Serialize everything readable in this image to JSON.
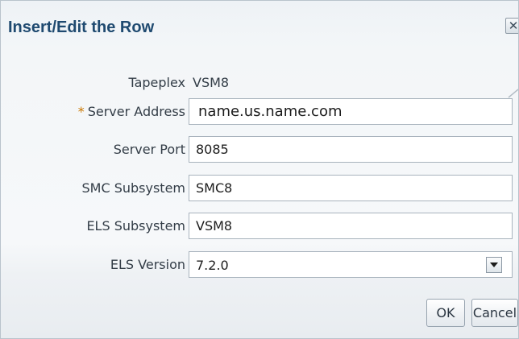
{
  "dialog": {
    "title": "Insert/Edit the Row",
    "close_icon": "close-icon"
  },
  "form": {
    "tapeplex": {
      "label": "Tapeplex",
      "value": "VSM8"
    },
    "server_address": {
      "required_mark": "*",
      "label": "Server Address",
      "value": "name.us.name.com"
    },
    "server_port": {
      "label": "Server Port",
      "value": "8085"
    },
    "smc_subsystem": {
      "label": "SMC Subsystem",
      "value": "SMC8"
    },
    "els_subsystem": {
      "label": "ELS Subsystem",
      "value": "VSM8"
    },
    "els_version": {
      "label": "ELS Version",
      "selected": "7.2.0",
      "dropdown_icon": "chevron-down-icon"
    }
  },
  "buttons": {
    "ok": "OK",
    "cancel": "Cancel"
  },
  "colors": {
    "title": "#1f4a70",
    "required": "#c97700",
    "label": "#333d47"
  }
}
